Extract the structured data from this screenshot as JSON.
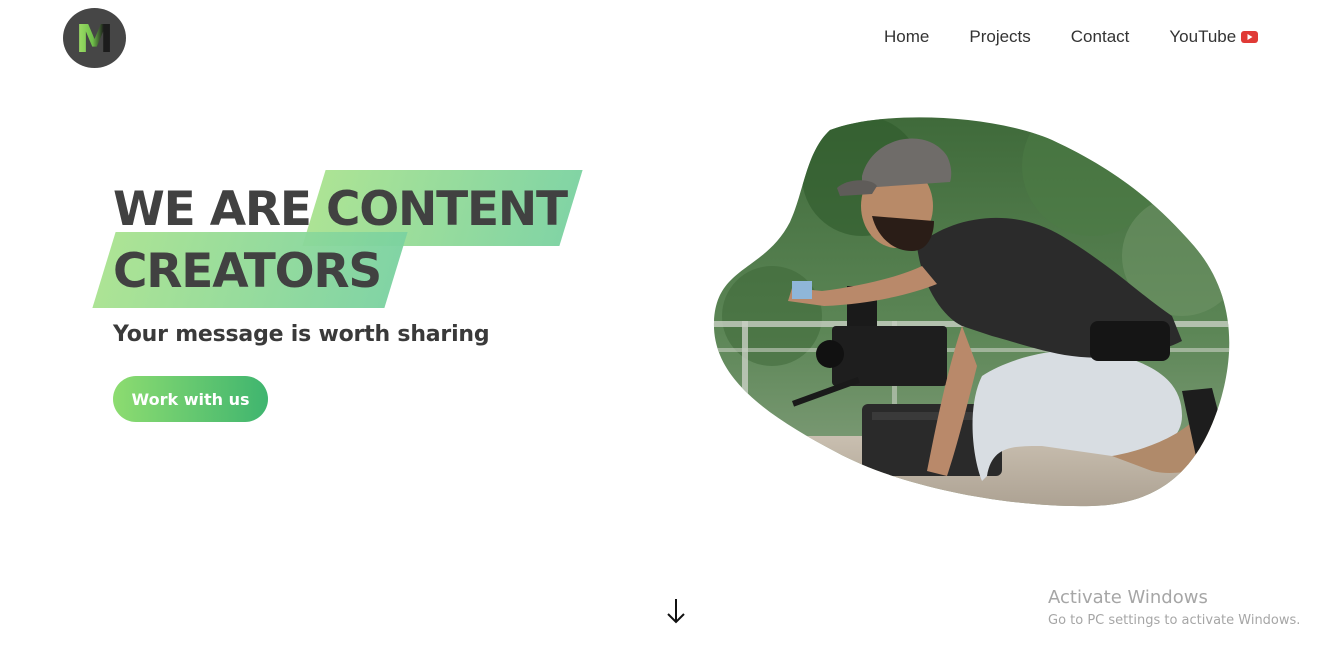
{
  "header": {
    "logo_letter": "M",
    "nav": [
      {
        "label": "Home"
      },
      {
        "label": "Projects"
      },
      {
        "label": "Contact"
      },
      {
        "label": "YouTube",
        "icon": "youtube-icon"
      }
    ]
  },
  "hero": {
    "title_line1": "WE ARE CONTENT",
    "title_line2": "CREATORS",
    "subtitle": "Your message is worth sharing",
    "cta_label": "Work with us",
    "image_icon": "videographer-photo"
  },
  "scroll_icon": "arrow-down-icon",
  "watermark": {
    "line1": "Activate Windows",
    "line2": "Go to PC settings to activate Windows."
  },
  "colors": {
    "accent_green": "#8ddc70",
    "accent_teal": "#3fb56f",
    "text_dark": "#414141",
    "youtube_red": "#e03a36",
    "logo_bg": "#464646"
  }
}
